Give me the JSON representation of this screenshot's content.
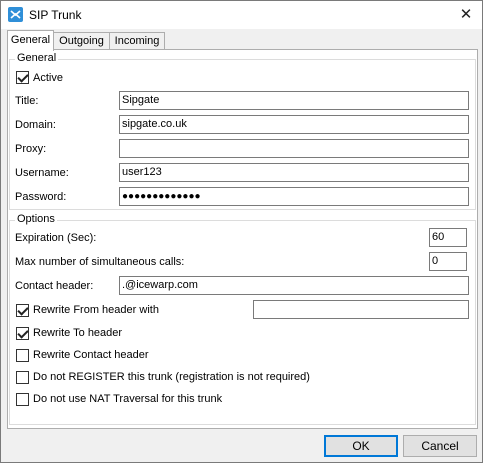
{
  "window": {
    "title": "SIP Trunk",
    "close_glyph": "✕"
  },
  "tabs": [
    {
      "label": "General",
      "active": true
    },
    {
      "label": "Outgoing",
      "active": false
    },
    {
      "label": "Incoming",
      "active": false
    }
  ],
  "general": {
    "legend": "General",
    "active": {
      "label": "Active",
      "checked": true
    },
    "fields": {
      "title": {
        "label": "Title:",
        "value": "Sipgate"
      },
      "domain": {
        "label": "Domain:",
        "value": "sipgate.co.uk"
      },
      "proxy": {
        "label": "Proxy:",
        "value": ""
      },
      "username": {
        "label": "Username:",
        "value": "user123"
      },
      "password": {
        "label": "Password:",
        "value": "●●●●●●●●●●●●●"
      }
    }
  },
  "options": {
    "legend": "Options",
    "expiration": {
      "label": "Expiration (Sec):",
      "value": "60"
    },
    "max_calls": {
      "label": "Max number of simultaneous calls:",
      "value": "0"
    },
    "contact_header": {
      "label": "Contact header:",
      "value": ".@icewarp.com"
    },
    "rewrite_from": {
      "label": "Rewrite From header with",
      "checked": true,
      "value": ""
    },
    "rewrite_to": {
      "label": "Rewrite To header",
      "checked": true
    },
    "rewrite_contact": {
      "label": "Rewrite Contact header",
      "checked": false
    },
    "no_register": {
      "label": "Do not REGISTER this trunk (registration is not required)",
      "checked": false
    },
    "no_nat": {
      "label": "Do not use NAT Traversal for this trunk",
      "checked": false
    }
  },
  "buttons": {
    "ok": "OK",
    "cancel": "Cancel"
  }
}
